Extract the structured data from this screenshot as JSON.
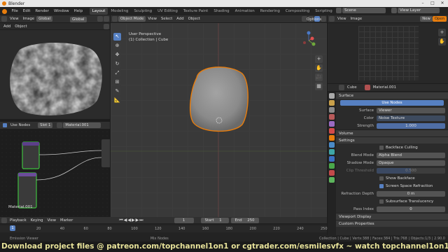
{
  "window": {
    "title": "Blender"
  },
  "menu": [
    "File",
    "Edit",
    "Render",
    "Window",
    "Help"
  ],
  "workspaces": [
    "Layout",
    "Modeling",
    "Sculpting",
    "UV Editing",
    "Texture Paint",
    "Shading",
    "Animation",
    "Rendering",
    "Compositing",
    "Scripting"
  ],
  "active_workspace": "Layout",
  "scene": {
    "scene_name": "Scene",
    "view_layer": "View Layer"
  },
  "image_editor": {
    "menus": [
      "View",
      "Image"
    ],
    "new_label": "New",
    "open_label": "Open"
  },
  "left_editor": {
    "menus": [
      "View",
      "Image",
      "Global"
    ]
  },
  "left_editor2": {
    "menus": [
      "Add",
      "Object"
    ]
  },
  "viewport": {
    "header": {
      "mode": "Object Mode",
      "menus": [
        "View",
        "Select",
        "Add",
        "Object"
      ],
      "orientation": "Global",
      "options_label": "Options"
    },
    "overlay_title": "User Perspective",
    "overlay_sub": "(1) Collection | Cube"
  },
  "node_editor": {
    "use_nodes_label": "Use Nodes",
    "slot": "Slot 1",
    "material": "Material.001",
    "label": "Material.001"
  },
  "properties": {
    "object": "Cube",
    "material": "Material.001",
    "surface_header": "Surface",
    "use_nodes_btn": "Use Nodes",
    "surface_label": "Surface",
    "surface_value": "Viewer",
    "color_label": "Color",
    "color_value": "Noise Texture",
    "strength_label": "Strength",
    "strength_value": "1.000",
    "volume_header": "Volume",
    "settings_header": "Settings",
    "backface_culling": "Backface Culling",
    "blend_mode_label": "Blend Mode",
    "blend_mode_value": "Alpha Blend",
    "shadow_mode_label": "Shadow Mode",
    "shadow_mode_value": "Opaque",
    "clip_label": "Clip Threshold",
    "clip_value": "0.500",
    "show_backface": "Show Backface",
    "ssr": "Screen Space Refraction",
    "refraction_depth_label": "Refraction Depth",
    "refraction_depth_value": "0 m",
    "sss": "Subsurface Translucency",
    "pass_index_label": "Pass Index",
    "pass_index_value": "0",
    "viewport_display_header": "Viewport Display",
    "custom_props_header": "Custom Properties"
  },
  "timeline": {
    "menus": [
      "Playback",
      "Keying",
      "View",
      "Marker"
    ],
    "current_frame": "1",
    "start_label": "Start",
    "start_value": "1",
    "end_label": "End",
    "end_value": "250",
    "ticks": [
      "1",
      "20",
      "40",
      "60",
      "80",
      "100",
      "120",
      "140",
      "160",
      "180",
      "200",
      "220",
      "240",
      "250"
    ]
  },
  "status": {
    "left": "Emission Viewer",
    "mid": "Mix Nodes",
    "right": "Collection | Cube | Verts:388 | Faces:384 | Tris:768 | Objects:1/3 | 2.90.0"
  },
  "banner": "Download project files @ patreon.com/topchannel1on1 or cgtrader.com/esmilesvfx  ~ watch topchannel1on1 or BlenderTemplates",
  "colors": {
    "accent": "#5680c2",
    "orange": "#e87d0d",
    "banner": "#e8e39a"
  }
}
